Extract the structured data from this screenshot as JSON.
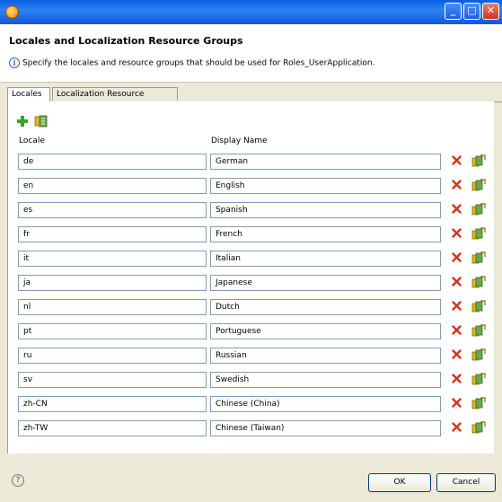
{
  "window": {
    "title": ""
  },
  "header": {
    "title": "Locales and Localization Resource Groups",
    "message": "Specify the locales and resource groups that should be used for Roles_UserApplication."
  },
  "tabs": [
    {
      "label": "Locales",
      "active": true
    },
    {
      "label": "Localization Resource Groups",
      "active": false
    }
  ],
  "columns": {
    "locale": "Locale",
    "display_name": "Display Name"
  },
  "rows": [
    {
      "locale": "de",
      "display_name": "German"
    },
    {
      "locale": "en",
      "display_name": "English"
    },
    {
      "locale": "es",
      "display_name": "Spanish"
    },
    {
      "locale": "fr",
      "display_name": "French"
    },
    {
      "locale": "it",
      "display_name": "Italian"
    },
    {
      "locale": "ja",
      "display_name": "Japanese"
    },
    {
      "locale": "nl",
      "display_name": "Dutch"
    },
    {
      "locale": "pt",
      "display_name": "Portuguese"
    },
    {
      "locale": "ru",
      "display_name": "Russian"
    },
    {
      "locale": "sv",
      "display_name": "Swedish"
    },
    {
      "locale": "zh-CN",
      "display_name": "Chinese (China)"
    },
    {
      "locale": "zh-TW",
      "display_name": "Chinese (Taiwan)"
    }
  ],
  "buttons": {
    "ok": "OK",
    "cancel": "Cancel"
  },
  "icons": {
    "app": "app-icon",
    "add": "add-icon",
    "group": "resource-group-icon",
    "delete": "delete-icon",
    "edit": "edit-locale-icon",
    "help": "help-icon",
    "info": "info-icon"
  },
  "colors": {
    "titlebar": "#0a5fe0",
    "dialog_bg": "#ece9d8",
    "field_border": "#7f9db9",
    "delete_red": "#d8331d"
  }
}
